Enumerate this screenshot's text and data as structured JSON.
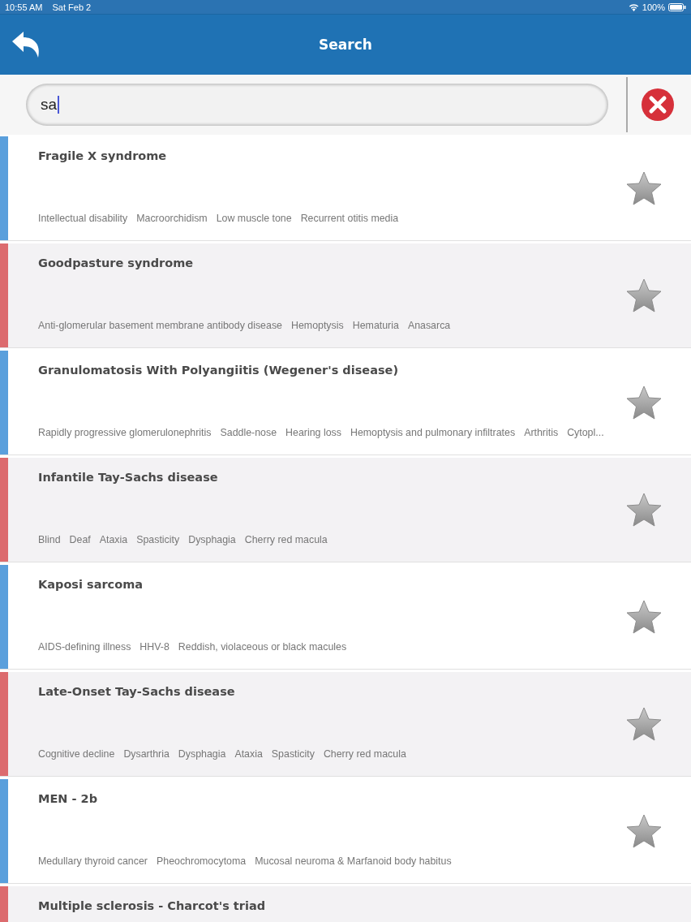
{
  "status_bar": {
    "time": "10:55 AM",
    "date": "Sat Feb 2",
    "battery": "100%"
  },
  "header": {
    "title": "Search"
  },
  "search": {
    "value": "sa"
  },
  "results": [
    {
      "title": "Fragile X syndrome",
      "color": "#5a9fdc",
      "tags": [
        "Intellectual disability",
        "Macroorchidism",
        "Low muscle tone",
        "Recurrent otitis media"
      ]
    },
    {
      "title": "Goodpasture syndrome",
      "color": "#dc6b6e",
      "tags": [
        "Anti-glomerular basement membrane antibody disease",
        "Hemoptysis",
        "Hematuria",
        "Anasarca"
      ]
    },
    {
      "title": "Granulomatosis With Polyangiitis (Wegener's disease)",
      "color": "#5a9fdc",
      "tags": [
        "Rapidly progressive glomerulonephritis",
        "Saddle-nose",
        "Hearing loss",
        "Hemoptysis and pulmonary infiltrates",
        "Arthritis",
        "Cytopl..."
      ]
    },
    {
      "title": "Infantile Tay-Sachs disease",
      "color": "#dc6b6e",
      "tags": [
        "Blind",
        "Deaf",
        "Ataxia",
        "Spasticity",
        "Dysphagia",
        "Cherry red macula"
      ]
    },
    {
      "title": "Kaposi sarcoma",
      "color": "#5a9fdc",
      "tags": [
        "AIDS-defining illness",
        "HHV-8",
        "Reddish,  violaceous or black macules"
      ]
    },
    {
      "title": "Late-Onset Tay-Sachs disease",
      "color": "#dc6b6e",
      "tags": [
        "Cognitive decline",
        "Dysarthria",
        "Dysphagia",
        "Ataxia",
        "Spasticity",
        "Cherry red macula"
      ]
    },
    {
      "title": "MEN - 2b",
      "color": "#5a9fdc",
      "tags": [
        "Medullary thyroid cancer",
        "Pheochromocytoma",
        "Mucosal neuroma & Marfanoid body habitus"
      ]
    },
    {
      "title": "Multiple sclerosis - Charcot's triad",
      "color": "#dc6b6e"
    }
  ]
}
